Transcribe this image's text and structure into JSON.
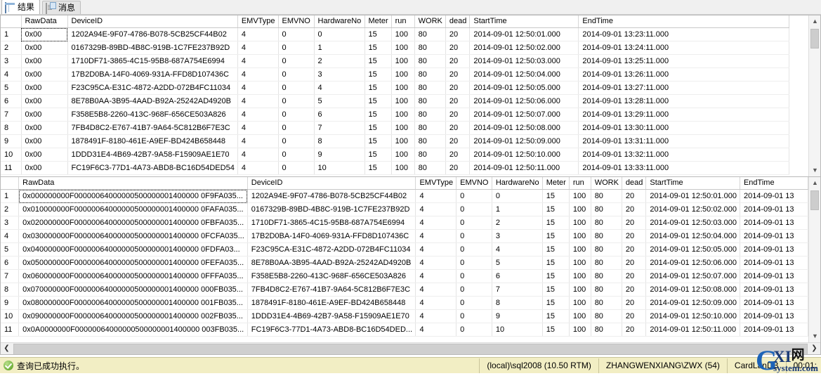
{
  "tabs": [
    {
      "label": "结果",
      "icon": "grid-icon",
      "active": true
    },
    {
      "label": "消息",
      "icon": "document-icon",
      "active": false
    }
  ],
  "grids": {
    "top": {
      "columns": [
        "",
        "RawData",
        "DeviceID",
        "EMVType",
        "EMVNO",
        "HardwareNo",
        "Meter",
        "run",
        "WORK",
        "dead",
        "StartTime",
        "EndTime"
      ],
      "rows": [
        [
          "1",
          "0x00",
          "1202A94E-9F07-4786-B078-5CB25CF44B02",
          "4",
          "0",
          "0",
          "15",
          "100",
          "80",
          "20",
          "2014-09-01 12:50:01.000",
          "2014-09-01 13:23:11.000"
        ],
        [
          "2",
          "0x00",
          "0167329B-89BD-4B8C-919B-1C7FE237B92D",
          "4",
          "0",
          "1",
          "15",
          "100",
          "80",
          "20",
          "2014-09-01 12:50:02.000",
          "2014-09-01 13:24:11.000"
        ],
        [
          "3",
          "0x00",
          "1710DF71-3865-4C15-95B8-687A754E6994",
          "4",
          "0",
          "2",
          "15",
          "100",
          "80",
          "20",
          "2014-09-01 12:50:03.000",
          "2014-09-01 13:25:11.000"
        ],
        [
          "4",
          "0x00",
          "17B2D0BA-14F0-4069-931A-FFD8D107436C",
          "4",
          "0",
          "3",
          "15",
          "100",
          "80",
          "20",
          "2014-09-01 12:50:04.000",
          "2014-09-01 13:26:11.000"
        ],
        [
          "5",
          "0x00",
          "F23C95CA-E31C-4872-A2DD-072B4FC11034",
          "4",
          "0",
          "4",
          "15",
          "100",
          "80",
          "20",
          "2014-09-01 12:50:05.000",
          "2014-09-01 13:27:11.000"
        ],
        [
          "6",
          "0x00",
          "8E78B0AA-3B95-4AAD-B92A-25242AD4920B",
          "4",
          "0",
          "5",
          "15",
          "100",
          "80",
          "20",
          "2014-09-01 12:50:06.000",
          "2014-09-01 13:28:11.000"
        ],
        [
          "7",
          "0x00",
          "F358E5B8-2260-413C-968F-656CE503A826",
          "4",
          "0",
          "6",
          "15",
          "100",
          "80",
          "20",
          "2014-09-01 12:50:07.000",
          "2014-09-01 13:29:11.000"
        ],
        [
          "8",
          "0x00",
          "7FB4D8C2-E767-41B7-9A64-5C812B6F7E3C",
          "4",
          "0",
          "7",
          "15",
          "100",
          "80",
          "20",
          "2014-09-01 12:50:08.000",
          "2014-09-01 13:30:11.000"
        ],
        [
          "9",
          "0x00",
          "1878491F-8180-461E-A9EF-BD424B658448",
          "4",
          "0",
          "8",
          "15",
          "100",
          "80",
          "20",
          "2014-09-01 12:50:09.000",
          "2014-09-01 13:31:11.000"
        ],
        [
          "10",
          "0x00",
          "1DDD31E4-4B69-42B7-9A58-F15909AE1E70",
          "4",
          "0",
          "9",
          "15",
          "100",
          "80",
          "20",
          "2014-09-01 12:50:10.000",
          "2014-09-01 13:32:11.000"
        ],
        [
          "11",
          "0x00",
          "FC19F6C3-77D1-4A73-ABD8-BC16D54DED54",
          "4",
          "0",
          "10",
          "15",
          "100",
          "80",
          "20",
          "2014-09-01 12:50:11.000",
          "2014-09-01 13:33:11.000"
        ]
      ],
      "selected_cell": {
        "row": 0,
        "col": 1
      }
    },
    "bottom": {
      "columns": [
        "",
        "RawData",
        "DeviceID",
        "EMVType",
        "EMVNO",
        "HardwareNo",
        "Meter",
        "run",
        "WORK",
        "dead",
        "StartTime",
        "EndTime"
      ],
      "rows": [
        [
          "1",
          "0x000000000F00000064000000500000001400000 0F9FA035...",
          "1202A94E-9F07-4786-B078-5CB25CF44B02",
          "4",
          "0",
          "0",
          "15",
          "100",
          "80",
          "20",
          "2014-09-01 12:50:01.000",
          "2014-09-01 13"
        ],
        [
          "2",
          "0x010000000F00000064000000500000001400000 0FAFA035...",
          "0167329B-89BD-4B8C-919B-1C7FE237B92D",
          "4",
          "0",
          "1",
          "15",
          "100",
          "80",
          "20",
          "2014-09-01 12:50:02.000",
          "2014-09-01 13"
        ],
        [
          "3",
          "0x020000000F00000064000000500000001400000 0FBFA035...",
          "1710DF71-3865-4C15-95B8-687A754E6994",
          "4",
          "0",
          "2",
          "15",
          "100",
          "80",
          "20",
          "2014-09-01 12:50:03.000",
          "2014-09-01 13"
        ],
        [
          "4",
          "0x030000000F00000064000000500000001400000 0FCFA035...",
          "17B2D0BA-14F0-4069-931A-FFD8D107436C",
          "4",
          "0",
          "3",
          "15",
          "100",
          "80",
          "20",
          "2014-09-01 12:50:04.000",
          "2014-09-01 13"
        ],
        [
          "5",
          "0x040000000F00000064000000500000001400000 0FDFA03...",
          "F23C95CA-E31C-4872-A2DD-072B4FC11034",
          "4",
          "0",
          "4",
          "15",
          "100",
          "80",
          "20",
          "2014-09-01 12:50:05.000",
          "2014-09-01 13"
        ],
        [
          "6",
          "0x050000000F00000064000000500000001400000 0FEFA035...",
          "8E78B0AA-3B95-4AAD-B92A-25242AD4920B",
          "4",
          "0",
          "5",
          "15",
          "100",
          "80",
          "20",
          "2014-09-01 12:50:06.000",
          "2014-09-01 13"
        ],
        [
          "7",
          "0x060000000F00000064000000500000001400000 0FFFA035...",
          "F358E5B8-2260-413C-968F-656CE503A826",
          "4",
          "0",
          "6",
          "15",
          "100",
          "80",
          "20",
          "2014-09-01 12:50:07.000",
          "2014-09-01 13"
        ],
        [
          "8",
          "0x070000000F00000064000000500000001400000 000FB035...",
          "7FB4D8C2-E767-41B7-9A64-5C812B6F7E3C",
          "4",
          "0",
          "7",
          "15",
          "100",
          "80",
          "20",
          "2014-09-01 12:50:08.000",
          "2014-09-01 13"
        ],
        [
          "9",
          "0x080000000F00000064000000500000001400000 001FB035...",
          "1878491F-8180-461E-A9EF-BD424B658448",
          "4",
          "0",
          "8",
          "15",
          "100",
          "80",
          "20",
          "2014-09-01 12:50:09.000",
          "2014-09-01 13"
        ],
        [
          "10",
          "0x090000000F00000064000000500000001400000 002FB035...",
          "1DDD31E4-4B69-42B7-9A58-F15909AE1E70",
          "4",
          "0",
          "9",
          "15",
          "100",
          "80",
          "20",
          "2014-09-01 12:50:10.000",
          "2014-09-01 13"
        ],
        [
          "11",
          "0x0A0000000F00000064000000500000001400000 003FB035...",
          "FC19F6C3-77D1-4A73-ABD8-BC16D54DED...",
          "4",
          "0",
          "10",
          "15",
          "100",
          "80",
          "20",
          "2014-09-01 12:50:11.000",
          "2014-09-01 13"
        ]
      ],
      "selected_cell": {
        "row": 0,
        "col": 1
      }
    }
  },
  "statusbar": {
    "message": "查询已成功执行。",
    "server": "(local)\\sql2008 (10.50 RTM)",
    "user": "ZHANGWENXIANG\\ZWX (54)",
    "database": "CardLanDB",
    "elapsed": "00:01:"
  },
  "watermark": {
    "g": "G",
    "xi": "XI",
    "cn": "网",
    "site": "system.com"
  },
  "scroll_icons": {
    "up": "▲",
    "down": "▼",
    "left": "❮",
    "right": "❯"
  },
  "colors": {
    "statusbar_bg": "#f2eec4",
    "status_ok": "#6fae3a",
    "selection": "#eceef1",
    "watermark_blue": "#1c63b8"
  }
}
